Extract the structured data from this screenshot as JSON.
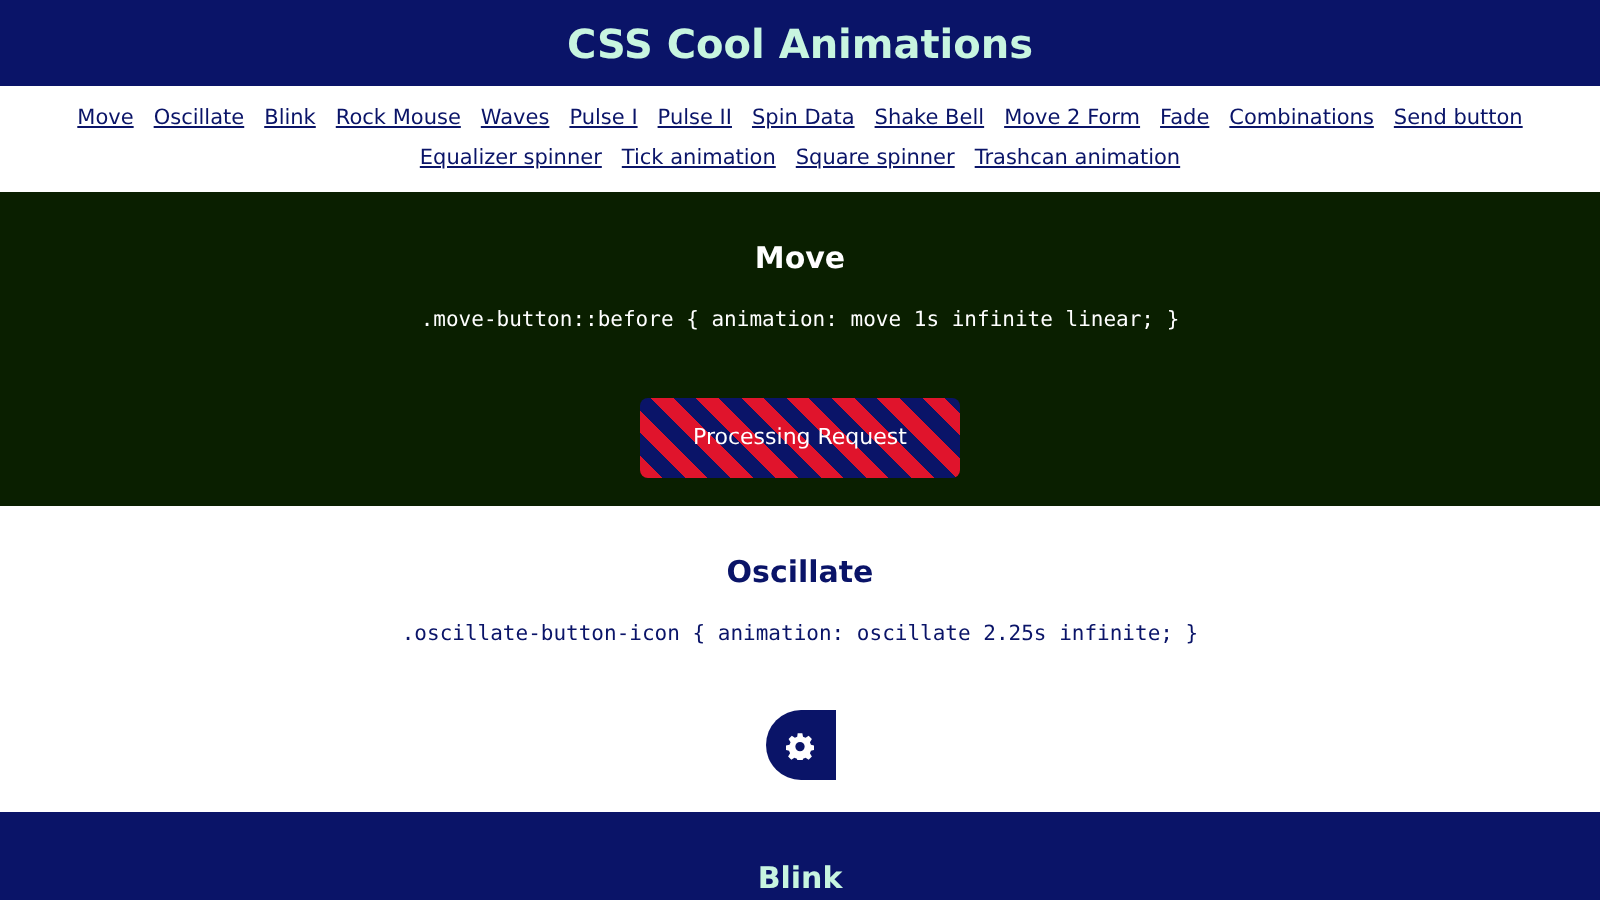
{
  "header": {
    "title": "CSS Cool Animations"
  },
  "nav": [
    {
      "label": "Move"
    },
    {
      "label": "Oscillate"
    },
    {
      "label": "Blink"
    },
    {
      "label": "Rock Mouse"
    },
    {
      "label": "Waves"
    },
    {
      "label": "Pulse I"
    },
    {
      "label": "Pulse II"
    },
    {
      "label": "Spin Data"
    },
    {
      "label": "Shake Bell"
    },
    {
      "label": "Move 2 Form"
    },
    {
      "label": "Fade"
    },
    {
      "label": "Combinations"
    },
    {
      "label": "Send button"
    },
    {
      "label": "Equalizer spinner"
    },
    {
      "label": "Tick animation"
    },
    {
      "label": "Square spinner"
    },
    {
      "label": "Trashcan animation"
    }
  ],
  "sections": [
    {
      "kind": "move",
      "title": "Move",
      "code": ".move-button::before { animation: move 1s infinite linear; }",
      "button": "Processing Request"
    },
    {
      "kind": "oscillate",
      "title": "Oscillate",
      "code": ".oscillate-button-icon { animation: oscillate 2.25s infinite; }"
    },
    {
      "kind": "blink",
      "title": "Blink"
    }
  ]
}
